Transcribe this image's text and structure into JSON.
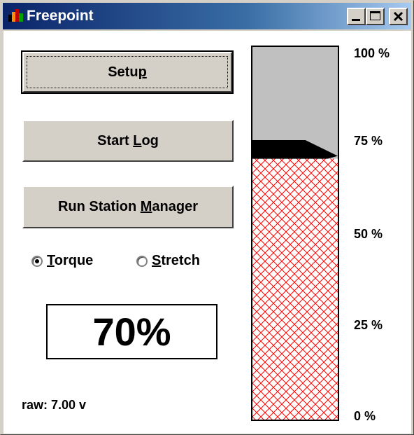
{
  "window": {
    "title": "Freepoint",
    "controls": [
      "minimize",
      "maximize",
      "close"
    ]
  },
  "buttons": {
    "setup": {
      "pre": "Setu",
      "u": "p",
      "post": ""
    },
    "start_log": {
      "pre": "Start ",
      "u": "L",
      "post": "og"
    },
    "run_station_manager": {
      "pre": "Run Station ",
      "u": "M",
      "post": "anager"
    }
  },
  "mode": {
    "options": [
      {
        "u": "T",
        "rest": "orque",
        "selected": true
      },
      {
        "u": "S",
        "rest": "tretch",
        "selected": false
      }
    ]
  },
  "readout": {
    "value": "70%"
  },
  "raw": {
    "label": "raw: 7.00 v"
  },
  "gauge": {
    "level": 0.7,
    "marker_band": 0.05,
    "ticks": [
      "100 %",
      "75 %",
      "50 %",
      "25 %",
      "0 %"
    ],
    "fill_color": "#ff0000",
    "empty_color": "#c0c0c0",
    "marker_color": "#000000"
  }
}
